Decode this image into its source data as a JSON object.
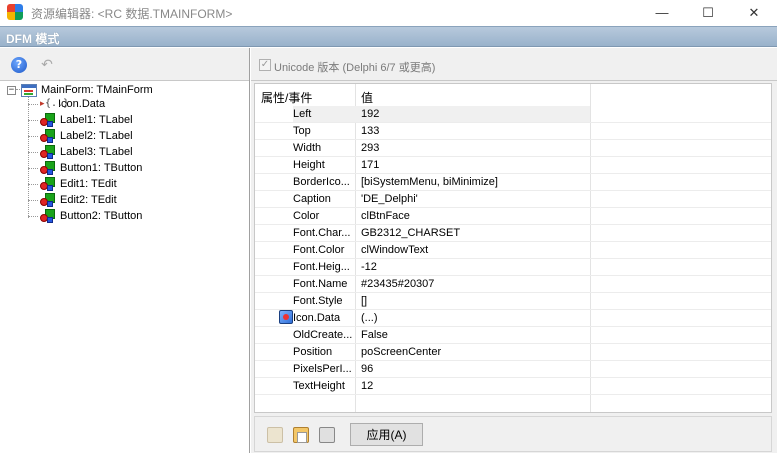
{
  "window": {
    "title": "资源编辑器: <RC 数据.TMAINFORM>",
    "minimize_glyph": "—",
    "maximize_glyph": "☐",
    "close_glyph": "✕"
  },
  "header": {
    "title": "DFM 模式"
  },
  "left_toolbar": {
    "help_glyph": "?",
    "undo_glyph": "↶"
  },
  "tree": {
    "root": "MainForm: TMainForm",
    "children": [
      {
        "label": "Icon.Data",
        "kind": "data"
      },
      {
        "label": "Label1: TLabel",
        "kind": "component"
      },
      {
        "label": "Label2: TLabel",
        "kind": "component"
      },
      {
        "label": "Label3: TLabel",
        "kind": "component"
      },
      {
        "label": "Button1: TButton",
        "kind": "component"
      },
      {
        "label": "Edit1: TEdit",
        "kind": "component"
      },
      {
        "label": "Edit2: TEdit",
        "kind": "component"
      },
      {
        "label": "Button2: TButton",
        "kind": "component"
      }
    ]
  },
  "unicode_option": {
    "label": "Unicode 版本 (Delphi 6/7 或更高)",
    "checked": true,
    "check_glyph": "✓"
  },
  "grid": {
    "header_property": "属性/事件",
    "header_value": "值",
    "rows": [
      {
        "name": "Left",
        "value": "192"
      },
      {
        "name": "Top",
        "value": "133"
      },
      {
        "name": "Width",
        "value": "293"
      },
      {
        "name": "Height",
        "value": "171"
      },
      {
        "name": "BorderIco...",
        "value": "[biSystemMenu, biMinimize]"
      },
      {
        "name": "Caption",
        "value": "'DE_Delphi'"
      },
      {
        "name": "Color",
        "value": "clBtnFace"
      },
      {
        "name": "Font.Char...",
        "value": "GB2312_CHARSET"
      },
      {
        "name": "Font.Color",
        "value": "clWindowText"
      },
      {
        "name": "Font.Heig...",
        "value": "-12"
      },
      {
        "name": "Font.Name",
        "value": "#23435#20307"
      },
      {
        "name": "Font.Style",
        "value": "[]"
      },
      {
        "name": "Icon.Data",
        "value": "(...)"
      },
      {
        "name": "OldCreate...",
        "value": "False"
      },
      {
        "name": "Position",
        "value": "poScreenCenter"
      },
      {
        "name": "PixelsPerI...",
        "value": "96"
      },
      {
        "name": "TextHeight",
        "value": "12"
      }
    ]
  },
  "bottom": {
    "apply_label": "应用(A)"
  }
}
